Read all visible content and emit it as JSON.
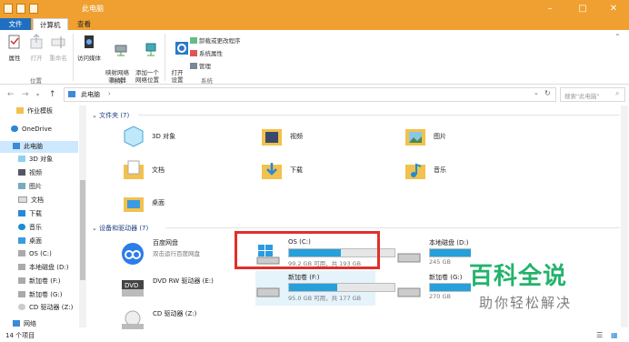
{
  "window": {
    "title": "此电脑"
  },
  "tabs": {
    "file": "文件",
    "computer": "计算机",
    "view": "查看"
  },
  "ribbon": {
    "properties": "属性",
    "open": "打开",
    "rename": "重命名",
    "access_media": "访问媒体",
    "map_drive": "映射网络\n驱动器",
    "add_network": "添加一个\n网络位置",
    "open_settings": "打开\n设置",
    "uninstall": "卸载或更改程序",
    "sys_props": "系统属性",
    "manage": "管理",
    "group_location": "位置",
    "group_network": "网络",
    "group_system": "系统"
  },
  "address": {
    "path": "此电脑",
    "search_placeholder": "搜索\"此电脑\""
  },
  "sidebar": {
    "items": [
      {
        "label": "作业模板",
        "icon": "folder-icon"
      },
      {
        "label": "OneDrive",
        "icon": "cloud-icon"
      },
      {
        "label": "此电脑",
        "icon": "computer-icon"
      },
      {
        "label": "3D 对象",
        "icon": "3d-objects-icon"
      },
      {
        "label": "视频",
        "icon": "video-icon"
      },
      {
        "label": "图片",
        "icon": "pictures-icon"
      },
      {
        "label": "文档",
        "icon": "documents-icon"
      },
      {
        "label": "下载",
        "icon": "download-icon"
      },
      {
        "label": "音乐",
        "icon": "music-icon"
      },
      {
        "label": "桌面",
        "icon": "desktop-icon"
      },
      {
        "label": "OS (C:)",
        "icon": "drive-icon"
      },
      {
        "label": "本地磁盘 (D:)",
        "icon": "drive-icon"
      },
      {
        "label": "新加卷 (F:)",
        "icon": "drive-icon"
      },
      {
        "label": "新加卷 (G:)",
        "icon": "drive-icon"
      },
      {
        "label": "CD 驱动器 (Z:)",
        "icon": "cd-icon"
      },
      {
        "label": "网络",
        "icon": "network-icon"
      }
    ]
  },
  "folders_header": "文件夹 (7)",
  "folders": [
    "3D 对象",
    "视频",
    "图片",
    "文档",
    "下载",
    "音乐",
    "桌面"
  ],
  "devices_header": "设备和驱动器 (7)",
  "devices": {
    "baidu": {
      "name": "百度网盘",
      "desc": "双击运行百度网盘"
    },
    "dvd": {
      "name": "DVD RW 驱动器 (E:)"
    },
    "cd": {
      "name": "CD 驱动器 (Z:)"
    },
    "c": {
      "name": "OS (C:)",
      "size": "99.2 GB 可用，共 193 GB",
      "used_fraction": 0.49
    },
    "f": {
      "name": "新加卷 (F:)",
      "size": "95.0 GB 可用，共 177 GB",
      "used_fraction": 0.46
    },
    "d": {
      "name": "本地磁盘 (D:)",
      "size": "245 GB",
      "used_fraction": 0.55
    },
    "g": {
      "name": "新加卷 (G:)",
      "size": "270 GB",
      "used_fraction": 0.4
    }
  },
  "status": {
    "count": "14 个项目"
  },
  "watermark": {
    "line1": "百科全说",
    "line2": "助你轻松解决"
  },
  "colors": {
    "accent": "#f0a030",
    "select": "#cde8ff",
    "bar": "#26a0da",
    "highlight": "#e0302b"
  }
}
